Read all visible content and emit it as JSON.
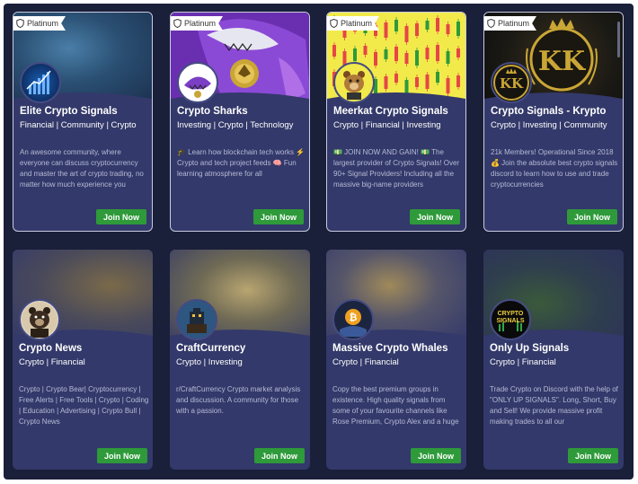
{
  "badge_label": "Platinum",
  "join_label": "Join Now",
  "colors": {
    "card_bg": "#33396a",
    "page_bg": "#1a1f3a",
    "join_bg": "#2e9a3a"
  },
  "cards": [
    {
      "title": "Elite Crypto Signals",
      "tags": "Financial | Community | Crypto",
      "description": "An awesome community, where everyone can discuss cryptocurrency and master the art of crypto trading, no matter how much experience you"
    },
    {
      "title": "Crypto Sharks",
      "tags": "Investing | Crypto | Technology",
      "description": "🎓 Learn how blockchain tech works ⚡ Crypto and tech project feeds 🧠 Fun learning atmosphere for all"
    },
    {
      "title": "Meerkat Crypto Signals",
      "tags": "Crypto | Financial | Investing",
      "description": "💵 JOIN NOW AND GAIN! 💵 The largest provider of Crypto Signals! Over 90+ Signal Providers! Including all the massive big-name providers"
    },
    {
      "title": "Crypto Signals - Krypto",
      "tags": "Crypto | Investing | Community",
      "description": "21k Members! Operational Since 2018 💰 Join the absolute best crypto signals discord to learn how to use and trade cryptocurrencies"
    },
    {
      "title": "Crypto News",
      "tags": "Crypto | Financial",
      "description": "Crypto | Crypto Bear| Cryptocurrency | Free Alerts | Free Tools | Crypto | Coding | Education | Advertising | Crypto Bull | Crypto News"
    },
    {
      "title": "CraftCurrency",
      "tags": "Crypto | Investing",
      "description": "r/CraftCurrency Crypto market analysis and discussion. A community for those with a passion."
    },
    {
      "title": "Massive Crypto Whales",
      "tags": "Crypto | Financial",
      "description": "Copy the best premium groups in existence. High quality signals from some of your favourite channels like Rose Premium, Crypto Alex and a huge"
    },
    {
      "title": "Only Up Signals",
      "tags": "Crypto | Financial",
      "description": "Trade Crypto on Discord with the help of \"ONLY UP SIGNALS\". Long, Short, Buy and Sell! We provide massive profit making trades to all our"
    },
    {
      "avatar_text": "CRYPTO SIGNALS"
    }
  ]
}
